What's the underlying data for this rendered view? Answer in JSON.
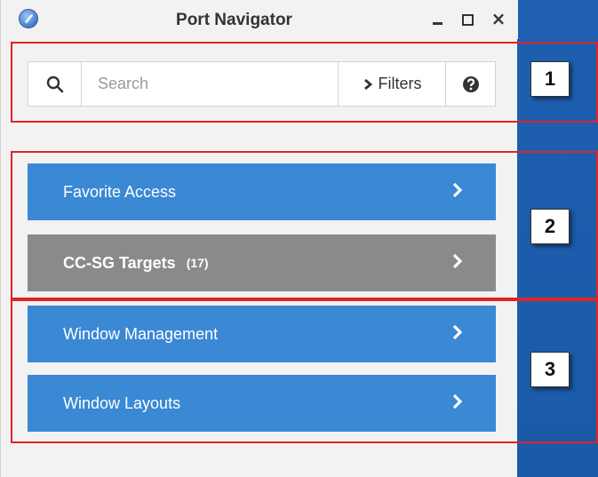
{
  "window": {
    "title": "Port Navigator",
    "minimize_icon": "minimize-icon",
    "maximize_icon": "maximize-icon",
    "close_label": "×"
  },
  "search": {
    "placeholder": "Search",
    "value": "",
    "filters_label": "Filters"
  },
  "menu": {
    "items": [
      {
        "label": "Favorite Access",
        "count": "",
        "style": "blue"
      },
      {
        "label": "CC-SG Targets",
        "count": "(17)",
        "style": "gray"
      },
      {
        "label": "Window Management",
        "count": "",
        "style": "blue"
      },
      {
        "label": "Window Layouts",
        "count": "",
        "style": "blue"
      }
    ]
  },
  "annotations": [
    "1",
    "2",
    "3"
  ],
  "colors": {
    "accent_blue": "#3b88d4",
    "selected_gray": "#8a8a8a",
    "annotation_red": "#e02424",
    "background_blue": "#1f5fb0"
  }
}
